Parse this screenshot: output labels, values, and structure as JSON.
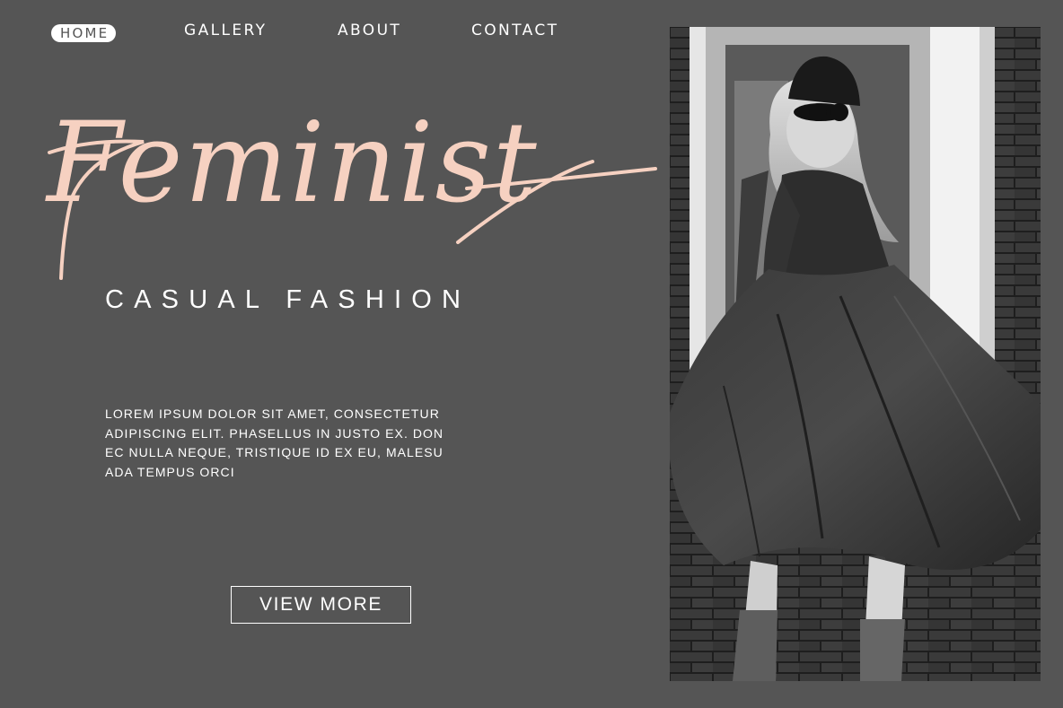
{
  "nav": {
    "items": [
      {
        "label": "HOME",
        "active": true
      },
      {
        "label": "GALLERY",
        "active": false
      },
      {
        "label": "ABOUT",
        "active": false
      },
      {
        "label": "CONTACT",
        "active": false
      }
    ]
  },
  "hero": {
    "title": "Feminist",
    "subtitle": "CASUAL FASHION",
    "body_lines": [
      "LOREM IPSUM DOLOR SIT AMET, CONSECTETUR",
      "ADIPISCING ELIT. PHASELLUS IN JUSTO EX. DON",
      "EC NULLA NEQUE, TRISTIQUE ID EX EU, MALESU",
      "ADA TEMPUS ORCI"
    ],
    "cta_label": "VIEW MORE"
  },
  "photo": {
    "subject": "woman-in-flared-dress-photo"
  },
  "colors": {
    "background": "#555555",
    "accent": "#f6d1c1",
    "text": "#ffffff"
  }
}
